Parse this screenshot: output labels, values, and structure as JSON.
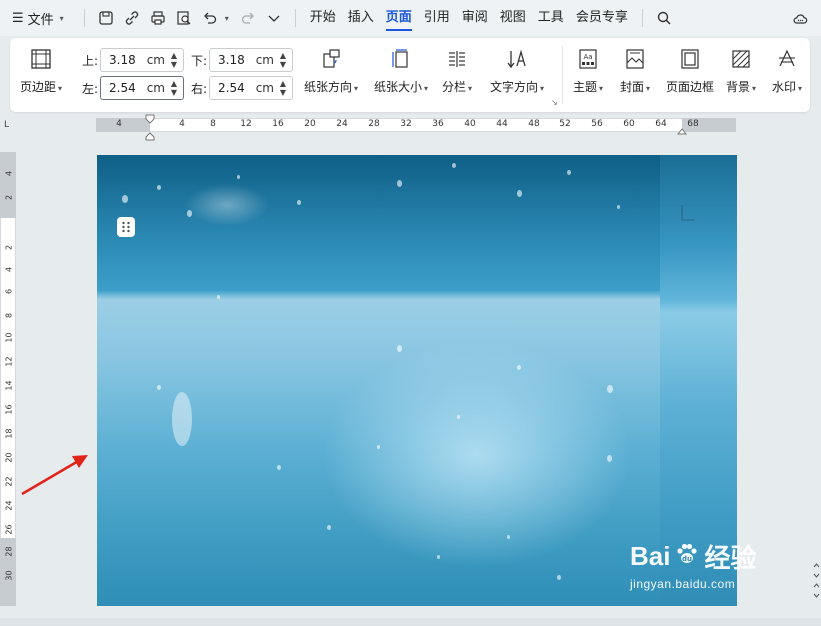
{
  "menubar": {
    "file_label": "文件",
    "tabs": [
      {
        "label": "开始",
        "active": false
      },
      {
        "label": "插入",
        "active": false
      },
      {
        "label": "页面",
        "active": true
      },
      {
        "label": "引用",
        "active": false
      },
      {
        "label": "审阅",
        "active": false
      },
      {
        "label": "视图",
        "active": false
      },
      {
        "label": "工具",
        "active": false
      },
      {
        "label": "会员专享",
        "active": false
      }
    ],
    "accent_color": "#1a56db"
  },
  "ribbon": {
    "margins_label": "页边距",
    "top_label": "上:",
    "top_value": "3.18",
    "bottom_label": "下:",
    "bottom_value": "3.18",
    "left_label": "左:",
    "left_value": "2.54",
    "right_label": "右:",
    "right_value": "2.54",
    "unit": "cm",
    "orientation_label": "纸张方向",
    "size_label": "纸张大小",
    "columns_label": "分栏",
    "text_direction_label": "文字方向",
    "theme_label": "主题",
    "cover_label": "封面",
    "page_border_label": "页面边框",
    "background_label": "背景",
    "watermark_label": "水印"
  },
  "ruler": {
    "corner_mark": "L",
    "horizontal_ticks": [
      "4",
      "4",
      "8",
      "12",
      "16",
      "20",
      "24",
      "28",
      "32",
      "36",
      "40",
      "44",
      "48",
      "52",
      "56",
      "60",
      "64",
      "68"
    ],
    "vertical_ticks": [
      "4",
      "2",
      "2",
      "4",
      "6",
      "8",
      "10",
      "12",
      "14",
      "16",
      "18",
      "20",
      "22",
      "24",
      "26",
      "28",
      "30"
    ]
  },
  "watermark": {
    "brand": "Bai du 经验",
    "brand_left": "Bai",
    "brand_right": "经验",
    "url": "jingyan.baidu.com"
  }
}
